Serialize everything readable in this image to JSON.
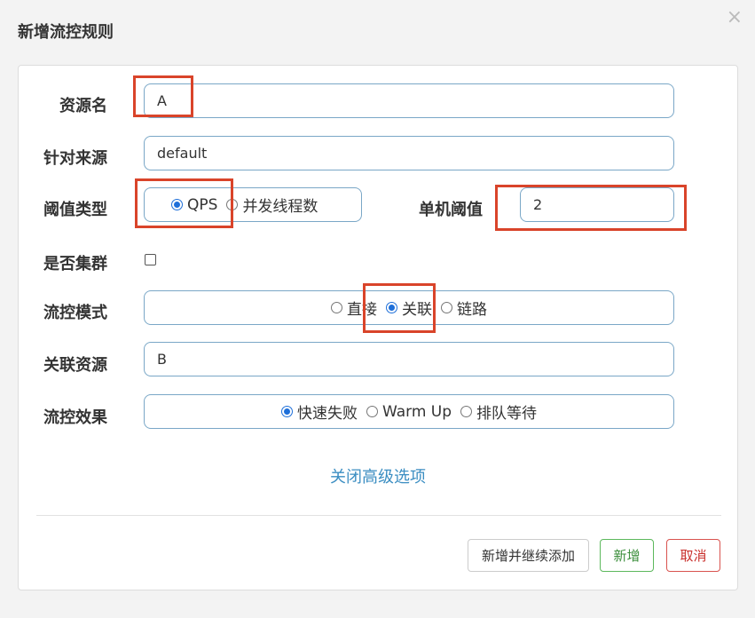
{
  "dialog": {
    "title": "新增流控规则",
    "close_glyph": "×"
  },
  "form": {
    "resource": {
      "label": "资源名",
      "value": "A"
    },
    "limit_app": {
      "label": "针对来源",
      "value": "default"
    },
    "grade": {
      "label": "阈值类型",
      "options": [
        "QPS",
        "并发线程数"
      ],
      "selected": "QPS"
    },
    "count": {
      "label": "单机阈值",
      "value": "2"
    },
    "cluster": {
      "label": "是否集群",
      "checked": false
    },
    "strategy": {
      "label": "流控模式",
      "options": [
        "直接",
        "关联",
        "链路"
      ],
      "selected": "关联"
    },
    "ref_resource": {
      "label": "关联资源",
      "value": "B"
    },
    "control_behavior": {
      "label": "流控效果",
      "options": [
        "快速失败",
        "Warm Up",
        "排队等待"
      ],
      "selected": "快速失败"
    },
    "advanced_link": "关闭高级选项"
  },
  "footer": {
    "add_continue_label": "新增并继续添加",
    "add_label": "新增",
    "cancel_label": "取消"
  },
  "colors": {
    "accent": "#1e6fd9",
    "input_border": "#7aa7c7",
    "highlight_box": "#d9442a",
    "link": "#3b8ec2"
  }
}
